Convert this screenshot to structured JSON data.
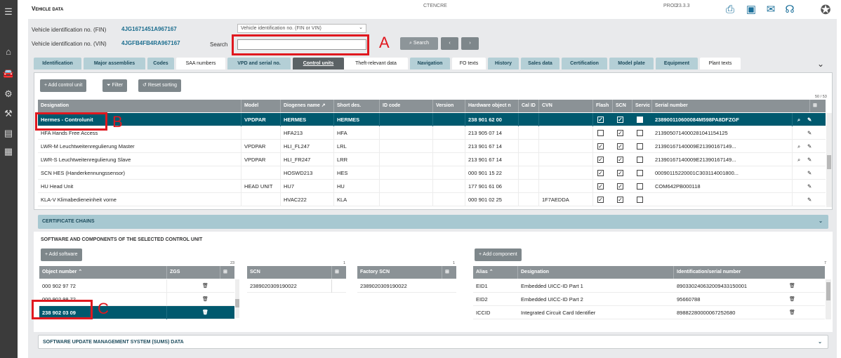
{
  "topbar": {
    "title": "Vehicle data",
    "center_text": "CTENCRE",
    "env": "PROD",
    "version": "23.3.3"
  },
  "vehicle": {
    "fin_label": "Vehicle identification no. (FIN)",
    "fin_value": "4JG1671451A967167",
    "vin_label": "Vehicle identification no. (VIN)",
    "vin_value": "4JGFB4FB4RA967167",
    "id_select": "Vehicle identification no. (FIN or VIN)",
    "search_label": "Search",
    "search_value": "",
    "search_button": "Search"
  },
  "annotations": {
    "a": "A",
    "b": "B",
    "c": "C"
  },
  "tabs": [
    "Identification",
    "Major assemblies",
    "Codes",
    "SAA numbers",
    "VPD and serial no.",
    "Control units",
    "Theft-relevant data",
    "Navigation",
    "FO texts",
    "History",
    "Sales data",
    "Certification",
    "Model plate",
    "Equipment",
    "Plant texts"
  ],
  "toolbar": {
    "add": "Add control unit",
    "filter": "Filter",
    "reset": "Reset sorting",
    "count": "50 / 53"
  },
  "cu_columns": [
    "Designation",
    "Model",
    "Diogenes name",
    "Short des.",
    "ID code",
    "Version",
    "Hardware object n",
    "Cal ID",
    "CVN",
    "Flash",
    "SCN",
    "Servic",
    "Serial number"
  ],
  "cu_rows": [
    {
      "designation": "Hermes - Controlunit",
      "model": "VPDPAR",
      "diogenes": "HERMES",
      "short": "HERMES",
      "hw": "238 901 62 00",
      "cvn": "",
      "flash": true,
      "scn": true,
      "serv": false,
      "serial": "238900110600084M598PA8DFZGF",
      "search": true,
      "edit": true,
      "selected": true
    },
    {
      "designation": "HFA Hands Free Access",
      "model": "",
      "diogenes": "HFA213",
      "short": "HFA",
      "hw": "213 905 07 14",
      "cvn": "",
      "flash": false,
      "scn": true,
      "serv": false,
      "serial": "2139050714000281041154125",
      "search": false,
      "edit": true
    },
    {
      "designation": "LWR-M Leuchtweitenregulierung Master",
      "model": "VPDPAR",
      "diogenes": "HLI_FL247",
      "short": "LRL",
      "hw": "213 901 67 14",
      "cvn": "",
      "flash": true,
      "scn": true,
      "serv": false,
      "serial": "21390167140009E21390167149...",
      "search": true,
      "edit": true
    },
    {
      "designation": "LWR-S Leuchtweitenregulierung Slave",
      "model": "VPDPAR",
      "diogenes": "HLI_FR247",
      "short": "LRR",
      "hw": "213 901 67 14",
      "cvn": "",
      "flash": true,
      "scn": true,
      "serv": false,
      "serial": "21390167140009E21390167149...",
      "search": true,
      "edit": true
    },
    {
      "designation": "SCN HES (Handerkennungssensor)",
      "model": "",
      "diogenes": "HOSWD213",
      "short": "HES",
      "hw": "000 901 15 22",
      "cvn": "",
      "flash": true,
      "scn": true,
      "serv": false,
      "serial": "00090115220001C303114001800...",
      "search": false,
      "edit": true
    },
    {
      "designation": "HU Head Unit",
      "model": "HEAD UNIT",
      "diogenes": "HU7",
      "short": "HU",
      "hw": "177 901 61 06",
      "cvn": "",
      "flash": true,
      "scn": true,
      "serv": false,
      "serial": "COM642PB000118",
      "search": false,
      "edit": true
    },
    {
      "designation": "KLA-V Klimabedieneinheit vorne",
      "model": "",
      "diogenes": "HVAC222",
      "short": "KLA",
      "hw": "000 901 02 25",
      "cvn": "1F7AEDDA",
      "flash": true,
      "scn": true,
      "serv": false,
      "serial": "",
      "search": false,
      "edit": true
    }
  ],
  "sections": {
    "cert": "CERTIFICATE CHAINS",
    "software": "SOFTWARE AND COMPONENTS OF THE SELECTED CONTROL UNIT",
    "sums": "SOFTWARE UPDATE MANAGEMENT SYSTEM (SUMS) DATA"
  },
  "software": {
    "add": "Add software",
    "count": "23",
    "col_object": "Object number",
    "col_zgs": "ZGS",
    "rows": [
      "000 902 97 72",
      "000 902 98 72",
      "238 902 03 09"
    ]
  },
  "scn": {
    "header": "SCN",
    "count": "1",
    "value": "2389020309190022"
  },
  "factory_scn": {
    "header": "Factory SCN",
    "count": "1",
    "value": "2389020309190022"
  },
  "component": {
    "add": "Add component",
    "count": "7",
    "col_alias": "Alias",
    "col_designation": "Designation",
    "col_serial": "Identification/serial number",
    "rows": [
      {
        "alias": "EID1",
        "designation": "Embedded UICC-ID Part 1",
        "serial": "8903302406320094331500​01"
      },
      {
        "alias": "EID2",
        "designation": "Embedded UICC-ID Part 2",
        "serial": "95660788"
      },
      {
        "alias": "ICCID",
        "designation": "Integrated Circuit Card Identifier",
        "serial": "89882280000067252680"
      }
    ]
  }
}
